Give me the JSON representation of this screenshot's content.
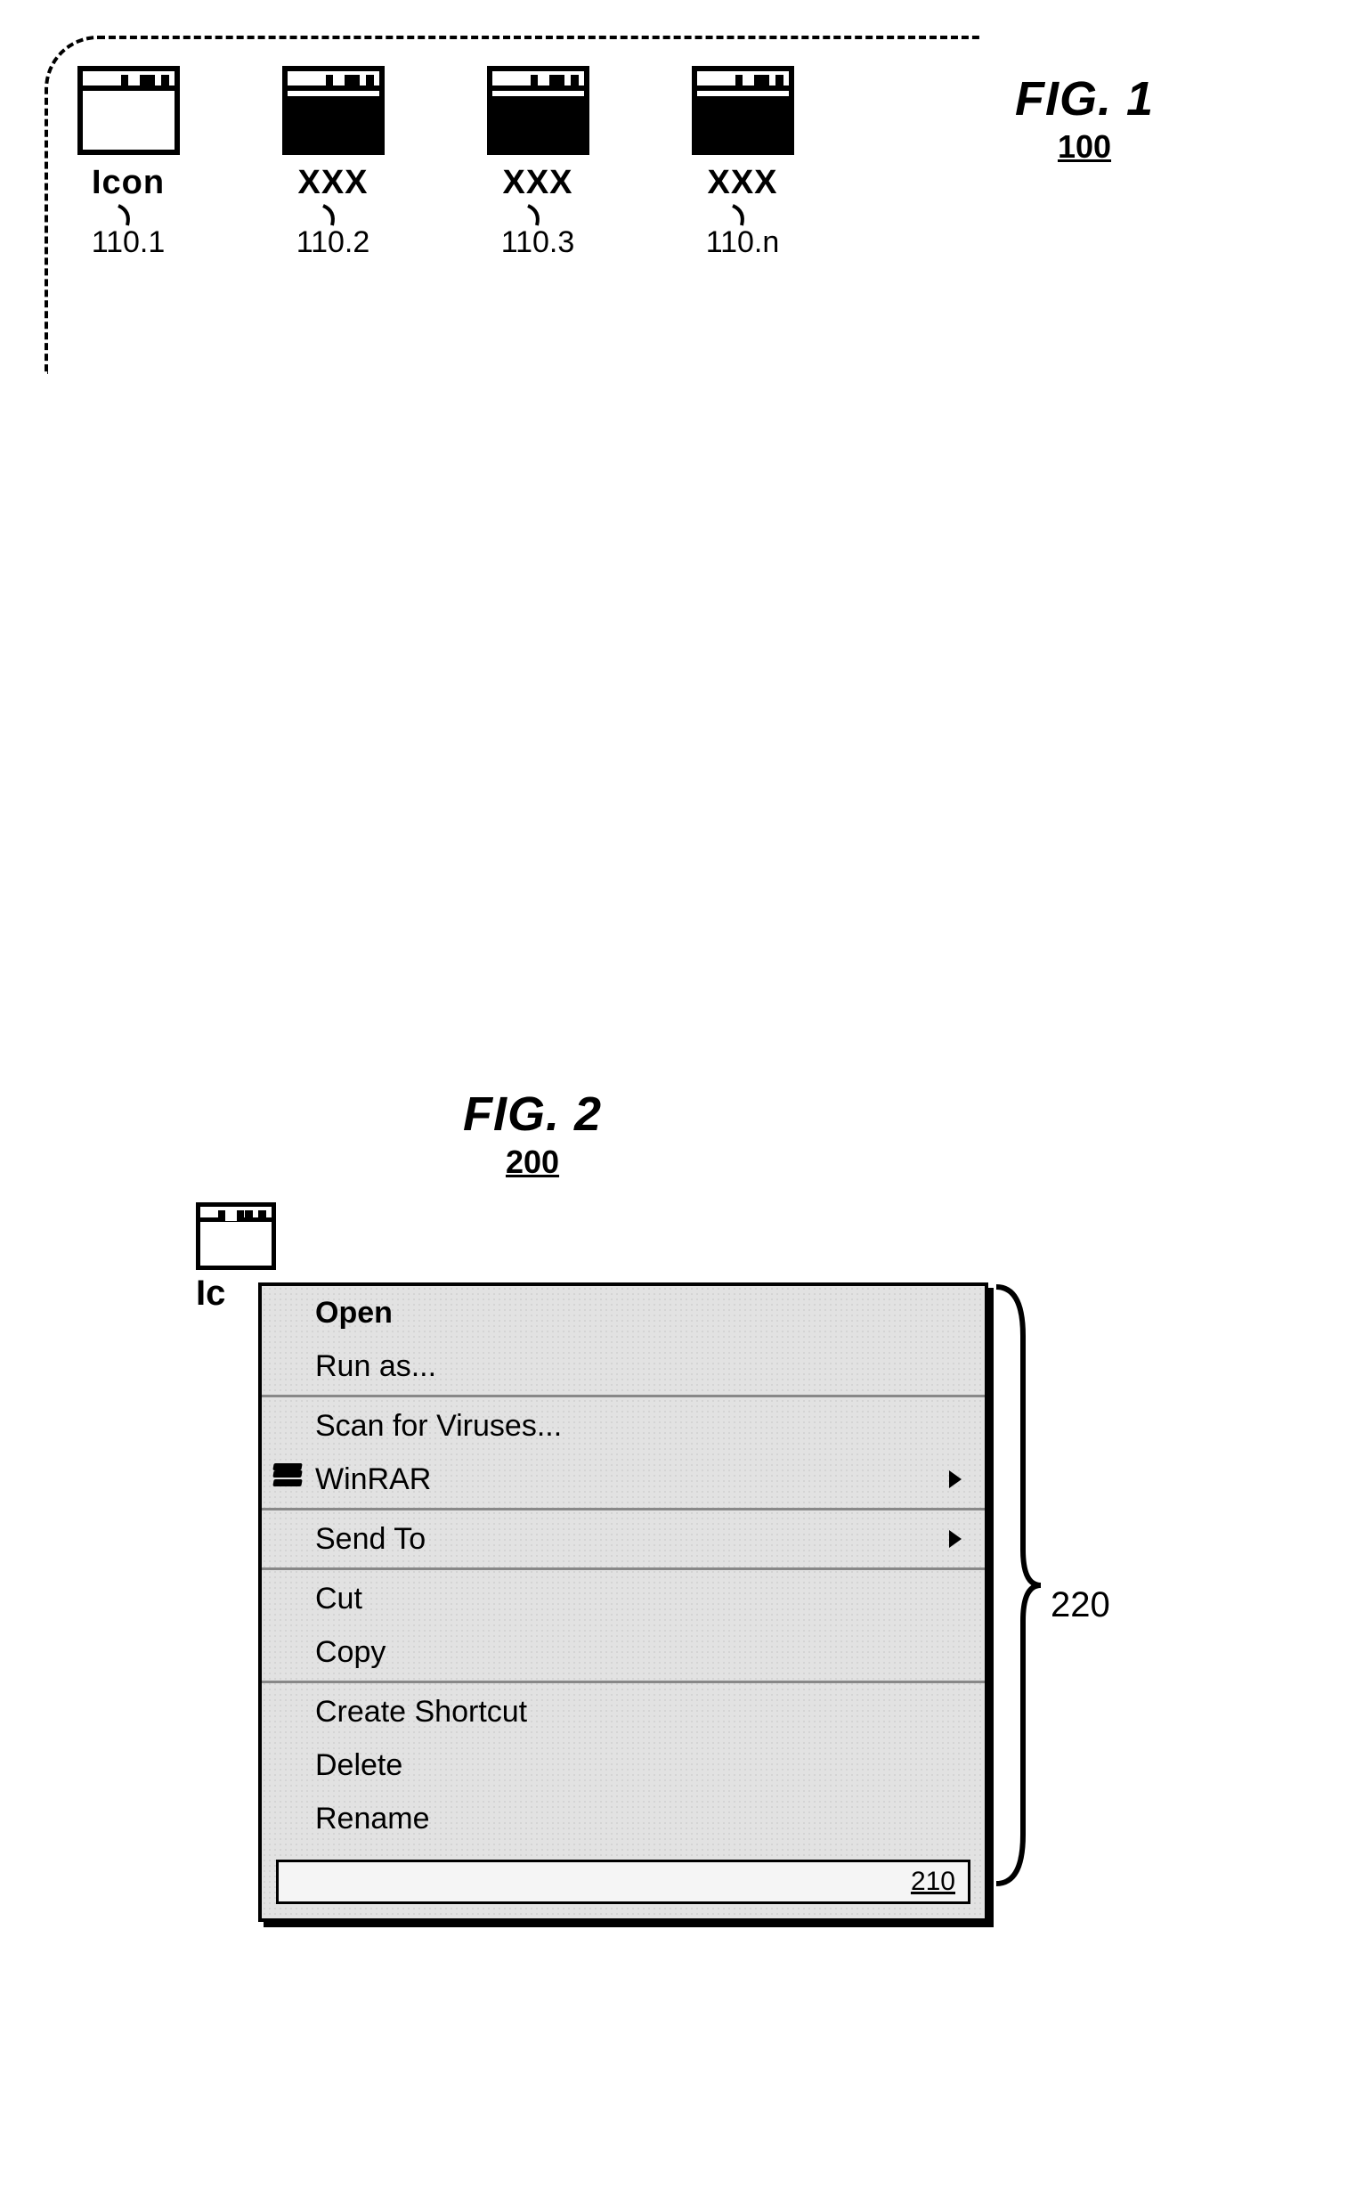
{
  "fig1": {
    "heading": "FIG. 1",
    "number": "100",
    "icons": [
      {
        "label": "Icon",
        "ref": "110.1",
        "fill": "white"
      },
      {
        "label": "XXX",
        "ref": "110.2",
        "fill": "black"
      },
      {
        "label": "XXX",
        "ref": "110.3",
        "fill": "black"
      },
      {
        "label": "XXX",
        "ref": "110.n",
        "fill": "black"
      }
    ]
  },
  "fig2": {
    "heading": "FIG. 2",
    "number": "200",
    "icon_partial_label": "Ic",
    "menu_ref": "220",
    "footer_ref": "210",
    "menu": [
      {
        "type": "item",
        "label": "Open",
        "bold": true
      },
      {
        "type": "item",
        "label": "Run as..."
      },
      {
        "type": "sep"
      },
      {
        "type": "item",
        "label": "Scan for Viruses..."
      },
      {
        "type": "item",
        "label": "WinRAR",
        "icon": "books",
        "submenu": true
      },
      {
        "type": "sep"
      },
      {
        "type": "item",
        "label": "Send To",
        "submenu": true
      },
      {
        "type": "sep"
      },
      {
        "type": "item",
        "label": "Cut"
      },
      {
        "type": "item",
        "label": "Copy"
      },
      {
        "type": "sep"
      },
      {
        "type": "item",
        "label": "Create Shortcut"
      },
      {
        "type": "item",
        "label": "Delete"
      },
      {
        "type": "item",
        "label": "Rename"
      }
    ]
  }
}
